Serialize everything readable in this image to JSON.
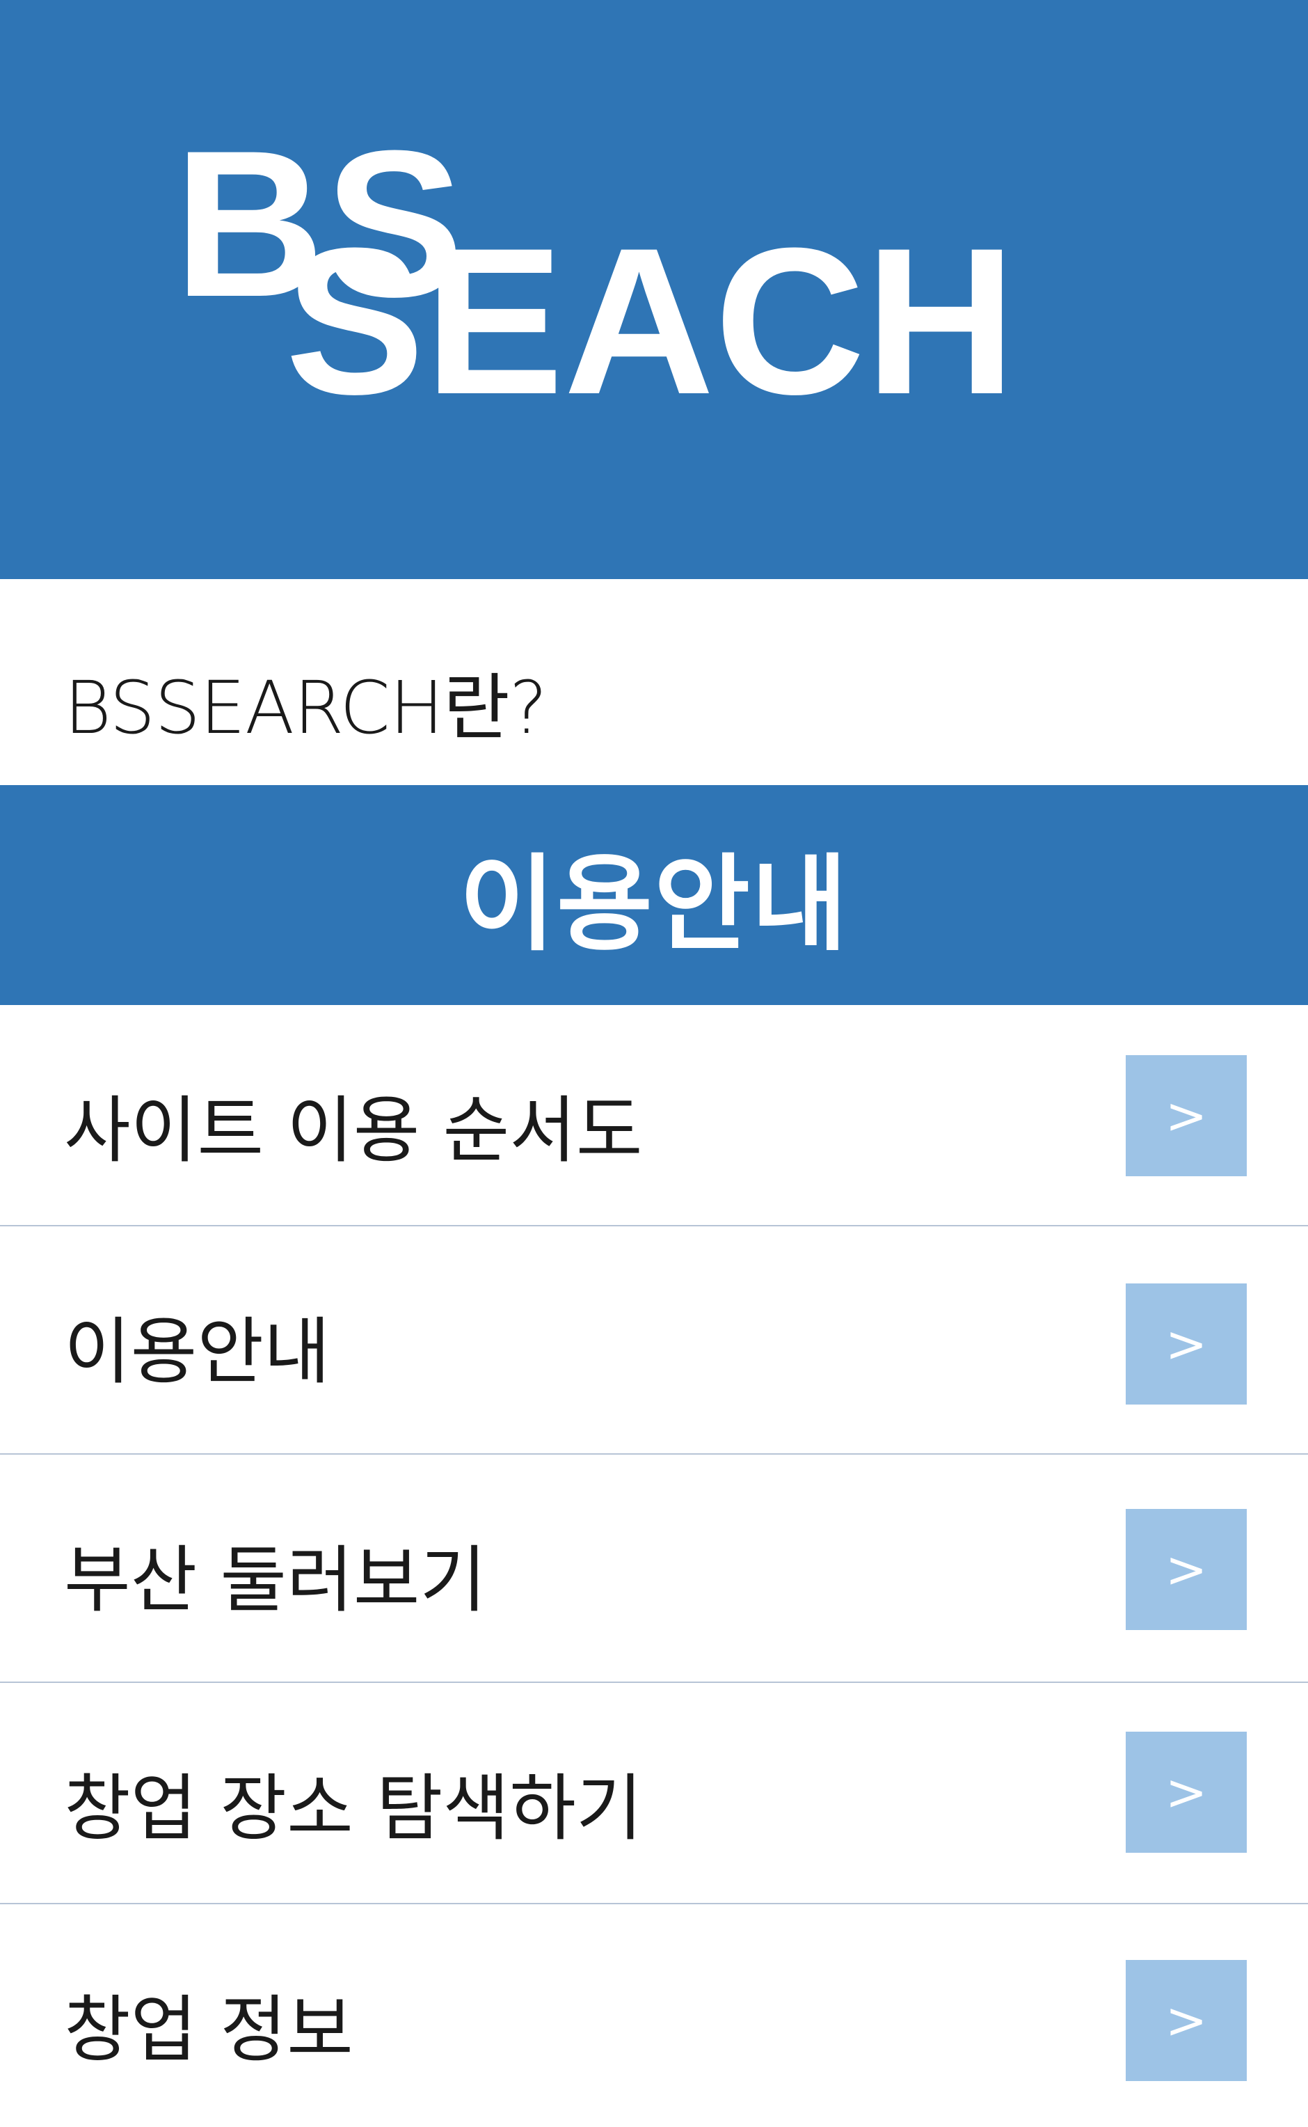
{
  "header": {
    "logo_text_1": "BS",
    "logo_text_2": "SEACH",
    "brand_color": "#2f75b5"
  },
  "about": {
    "label": "BSSEARCH란?"
  },
  "section": {
    "title": "이용안내"
  },
  "menu": {
    "items": [
      {
        "label": "사이트 이용 순서도",
        "arrow": ">"
      },
      {
        "label": "이용안내",
        "arrow": ">"
      },
      {
        "label": "부산 둘러보기",
        "arrow": ">"
      },
      {
        "label": "창업 장소 탐색하기",
        "arrow": ">"
      },
      {
        "label": "창업 정보",
        "arrow": ">"
      }
    ],
    "button_color": "#9dc3e6",
    "divider_color": "#b7c4d6"
  }
}
